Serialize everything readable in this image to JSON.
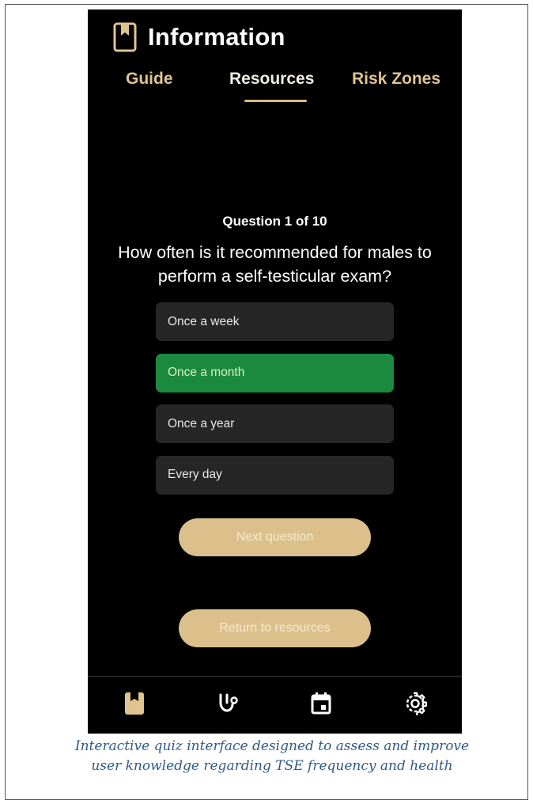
{
  "header": {
    "title": "Information",
    "icon": "bookmark-book-icon"
  },
  "tabs": [
    {
      "label": "Guide",
      "active": false
    },
    {
      "label": "Resources",
      "active": true
    },
    {
      "label": "Risk Zones",
      "active": false
    }
  ],
  "quiz": {
    "counter": "Question 1 of 10",
    "question": "How often is it recommended for males to perform a self-testicular exam?",
    "options": [
      {
        "label": "Once a week",
        "selected": false
      },
      {
        "label": "Once a month",
        "selected": true
      },
      {
        "label": "Once a year",
        "selected": false
      },
      {
        "label": "Every day",
        "selected": false
      }
    ],
    "next_label": "Next question",
    "return_label": "Return to resources"
  },
  "bottom_nav": [
    {
      "icon": "bookmark-icon",
      "active": true
    },
    {
      "icon": "stethoscope-icon",
      "active": false
    },
    {
      "icon": "calendar-icon",
      "active": false
    },
    {
      "icon": "gear-icon",
      "active": false
    }
  ],
  "caption": {
    "line1": "Interactive quiz interface designed to assess and improve",
    "line2": "user knowledge regarding TSE frequency and health"
  },
  "colors": {
    "background": "#000000",
    "accent": "#dcc08b",
    "selected_option": "#1b8a3f",
    "option_bg": "#262626",
    "caption": "#2f5a8a"
  }
}
